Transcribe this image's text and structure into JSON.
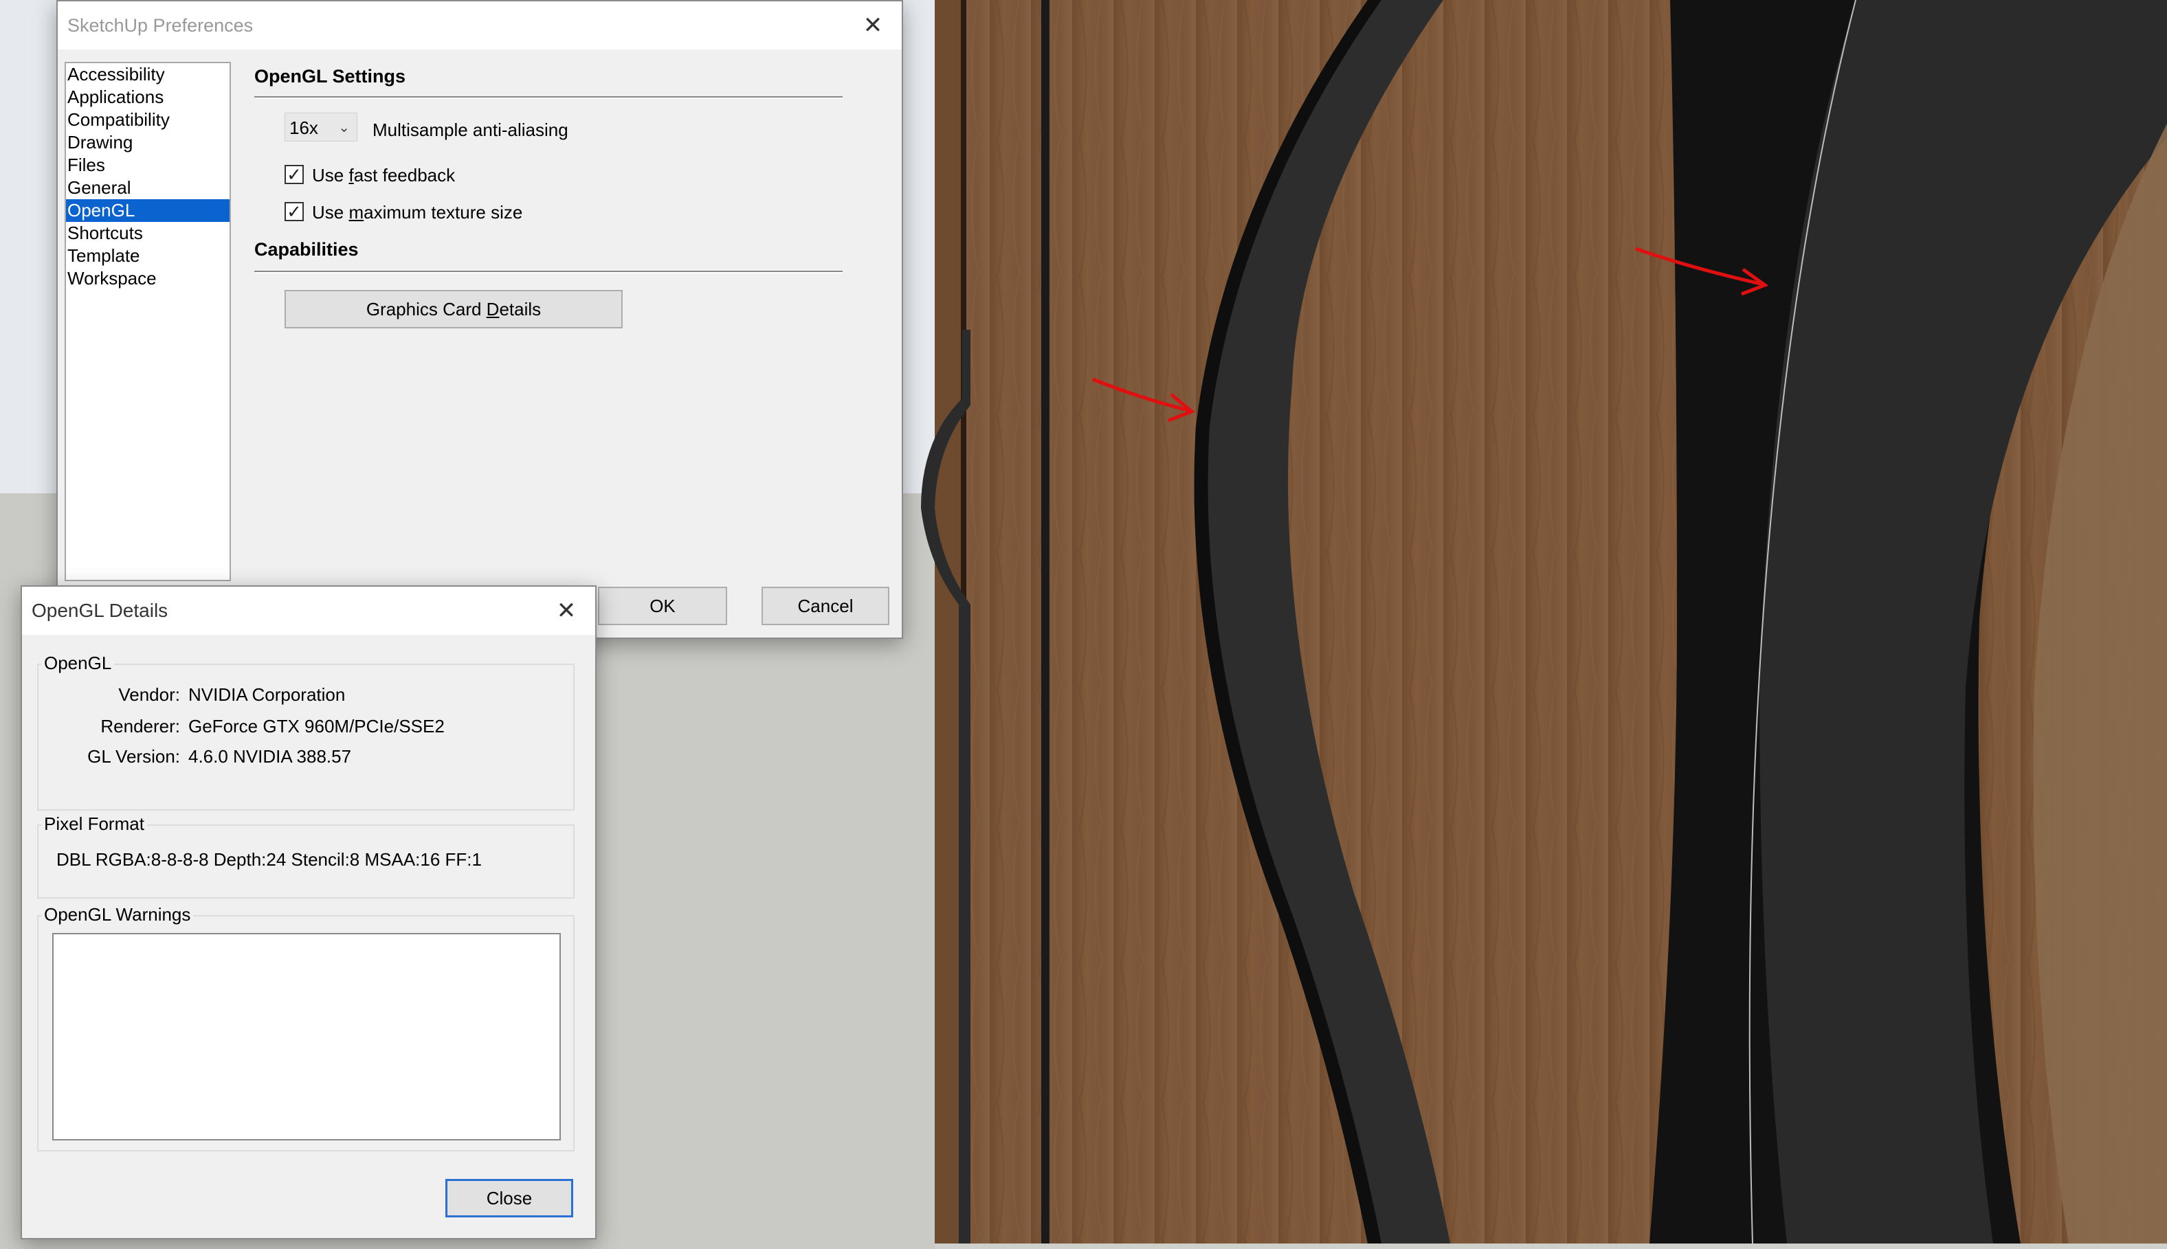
{
  "preferences": {
    "title": "SketchUp Preferences",
    "close_glyph": "✕",
    "categories": [
      {
        "label": "Accessibility"
      },
      {
        "label": "Applications"
      },
      {
        "label": "Compatibility"
      },
      {
        "label": "Drawing"
      },
      {
        "label": "Files"
      },
      {
        "label": "General"
      },
      {
        "label": "OpenGL"
      },
      {
        "label": "Shortcuts"
      },
      {
        "label": "Template"
      },
      {
        "label": "Workspace"
      }
    ],
    "selected_category": "OpenGL",
    "opengl_settings": {
      "heading": "OpenGL Settings",
      "msaa_value": "16x",
      "msaa_label": "Multisample anti-aliasing",
      "fast_feedback_pre": "Use ",
      "fast_feedback_u": "f",
      "fast_feedback_post": "ast feedback",
      "fast_feedback_checked": true,
      "max_texture_pre": "Use ",
      "max_texture_u": "m",
      "max_texture_post": "aximum texture size",
      "max_texture_checked": true,
      "check_glyph": "✓"
    },
    "capabilities": {
      "heading": "Capabilities",
      "details_pre": "Graphics Card ",
      "details_u": "D",
      "details_post": "etails"
    },
    "ok_label": "OK",
    "cancel_label": "Cancel"
  },
  "opengl_details": {
    "title": "OpenGL Details",
    "close_glyph": "✕",
    "opengl_group": {
      "label": "OpenGL",
      "vendor_key": "Vendor:",
      "vendor_val": "NVIDIA Corporation",
      "renderer_key": "Renderer:",
      "renderer_val": "GeForce GTX 960M/PCIe/SSE2",
      "version_key": "GL Version:",
      "version_val": "4.6.0 NVIDIA 388.57"
    },
    "pixel_format": {
      "label": "Pixel Format",
      "value": "DBL RGBA:8-8-8-8 Depth:24 Stencil:8 MSAA:16 FF:1"
    },
    "warnings": {
      "label": "OpenGL Warnings",
      "text": ""
    },
    "close_label": "Close"
  },
  "colors": {
    "selection": "#0a63cf",
    "wood": "#7a5235",
    "frame_dark": "#2b2b2b",
    "annotation_arrow": "#e01010"
  }
}
